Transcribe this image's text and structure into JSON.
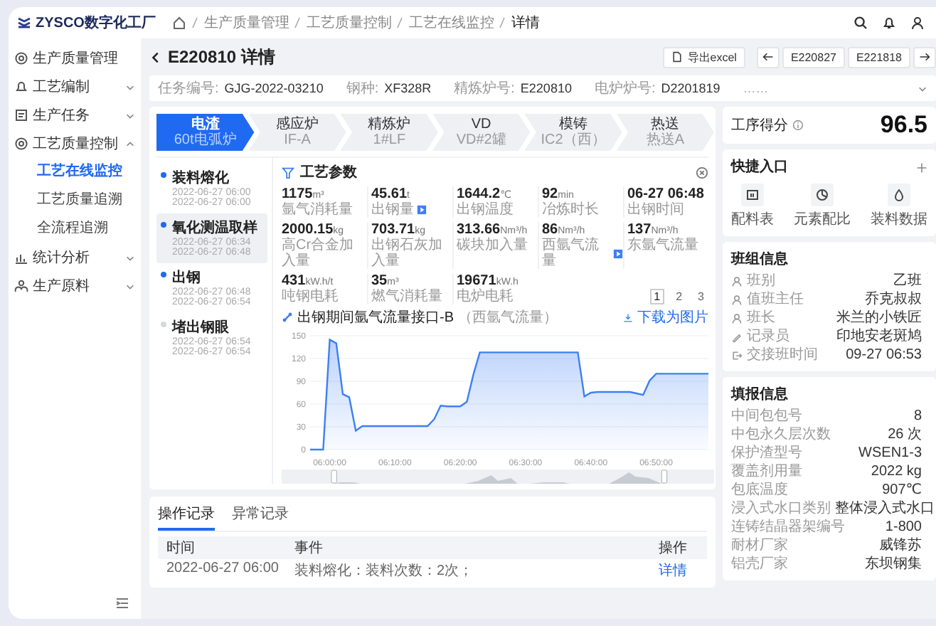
{
  "logo": "ZYSCO数字化工厂",
  "breadcrumb": [
    "生产质量管理",
    "工艺质量控制",
    "工艺在线监控",
    "详情"
  ],
  "sidebar": {
    "items": [
      {
        "label": "生产质量管理"
      },
      {
        "label": "工艺编制",
        "expanded": false
      },
      {
        "label": "生产任务",
        "expanded": false
      },
      {
        "label": "工艺质量控制",
        "expanded": true,
        "children": [
          {
            "label": "工艺在线监控",
            "selected": true
          },
          {
            "label": "工艺质量追溯",
            "selected": false
          },
          {
            "label": "全流程追溯",
            "selected": false
          }
        ]
      },
      {
        "label": "统计分析",
        "expanded": false
      },
      {
        "label": "生产原料",
        "expanded": false
      }
    ]
  },
  "page_title": "E220810 详情",
  "export_button": "导出excel",
  "nav": {
    "prev": "E220827",
    "next": "E221818"
  },
  "info_fields": [
    {
      "label": "任务编号:",
      "value": "GJG-2022-03210"
    },
    {
      "label": "钢种:",
      "value": "XF328R"
    },
    {
      "label": "精炼炉号:",
      "value": "E220810"
    },
    {
      "label": "电炉炉号:",
      "value": "D2201819"
    }
  ],
  "info_more": "……",
  "steps": [
    {
      "name": "电渣",
      "detail": "60t电弧炉",
      "selected": true
    },
    {
      "name": "感应炉",
      "detail": "IF-A",
      "selected": false
    },
    {
      "name": "精炼炉",
      "detail": "1#LF",
      "selected": false
    },
    {
      "name": "VD",
      "detail": "VD#2罐",
      "selected": false
    },
    {
      "name": "模铸",
      "detail": "IC2（西）",
      "selected": false
    },
    {
      "name": "热送",
      "detail": "热送A",
      "selected": false
    }
  ],
  "timeline": [
    {
      "name": "装料熔化",
      "start": "2022-06-27 06:00",
      "end": "2022-06-27 06:00",
      "done": true,
      "selected": false
    },
    {
      "name": "氧化测温取样",
      "start": "2022-06-27 06:34",
      "end": "2022-06-27 06:48",
      "done": true,
      "selected": true
    },
    {
      "name": "出钢",
      "start": "2022-06-27 06:48",
      "end": "2022-06-27 06:54",
      "done": true,
      "selected": false
    },
    {
      "name": "堵出钢眼",
      "start": "2022-06-27 06:54",
      "end": "2022-06-27 06:54",
      "done": false,
      "selected": false
    }
  ],
  "params": {
    "title": "工艺参数",
    "items": [
      {
        "value": "1175",
        "unit": "m³",
        "label": "氩气消耗量"
      },
      {
        "value": "45.61",
        "unit": "t",
        "label": "出钢量",
        "flag": true
      },
      {
        "value": "1644.2",
        "unit": "℃",
        "label": "出钢温度"
      },
      {
        "value": "92",
        "unit": "min",
        "label": "冶炼时长"
      },
      {
        "value": "06-27 06:48",
        "label": "出钢时间"
      },
      {
        "value": "2000.15",
        "unit": "kg",
        "label": "高Cr合金加入量"
      },
      {
        "value": "703.71",
        "unit": "kg",
        "label": "出钢石灰加入量"
      },
      {
        "value": "313.66",
        "unit": "Nm³/h",
        "label": "碳块加入量"
      },
      {
        "value": "86",
        "unit": "Nm³/h",
        "label": "西氩气流量",
        "flag": true
      },
      {
        "value": "137",
        "unit": "Nm³/h",
        "label": "东氩气流量"
      },
      {
        "value": "431",
        "unit": "kW.h/t",
        "label": "吨钢电耗"
      },
      {
        "value": "35",
        "unit": "m³",
        "label": "燃气消耗量"
      },
      {
        "value": "19671",
        "unit": "kW.h",
        "label": "电炉电耗"
      }
    ],
    "pages": [
      {
        "label": "1",
        "selected": true
      },
      {
        "label": "2",
        "selected": false
      },
      {
        "label": "3",
        "selected": false
      }
    ]
  },
  "chart": {
    "title": "出钢期间氩气流量接口-B",
    "subtitle": "（西氩气流量）",
    "download": "下载为图片",
    "chart_data": {
      "type": "area",
      "categories": [
        null,
        null,
        null,
        "06:00:00",
        null,
        null,
        null,
        null,
        null,
        null,
        null,
        null,
        null,
        "06:10:00",
        null,
        null,
        null,
        null,
        null,
        null,
        null,
        null,
        null,
        "06:20:00",
        null,
        null,
        null,
        null,
        null,
        null,
        null,
        null,
        null,
        "06:30:00",
        null,
        null,
        null,
        null,
        null,
        null,
        null,
        null,
        null,
        "06:40:00",
        null,
        null,
        null,
        null,
        null,
        null,
        null,
        null,
        null,
        "06:50:00",
        null,
        null,
        null,
        null,
        null,
        null,
        null,
        null
      ],
      "series": [
        {
          "color": "#3d7ff5",
          "values": [
            0,
            0,
            0,
            145,
            140,
            73,
            69,
            25,
            31,
            31,
            31,
            31,
            31,
            31,
            31,
            31,
            31,
            31,
            31,
            40,
            58,
            57,
            57,
            57,
            63,
            99,
            128,
            128,
            128,
            128,
            128,
            128,
            128,
            128,
            128,
            128,
            128,
            128,
            128,
            128,
            128,
            128,
            70,
            75,
            76,
            76,
            76,
            76,
            76,
            76,
            74,
            72,
            91,
            100,
            100,
            100,
            100,
            100,
            100,
            100,
            100,
            100
          ]
        }
      ],
      "ylim": [
        0,
        150
      ],
      "yticks": [
        0,
        30,
        60,
        90,
        120,
        150
      ],
      "grid": true
    }
  },
  "records": {
    "tabs": [
      {
        "label": "操作记录",
        "selected": true
      },
      {
        "label": "异常记录",
        "selected": false
      }
    ],
    "columns": [
      "时间",
      "事件",
      "操作"
    ],
    "rows": [
      [
        "2022-06-27 06:00",
        "装料熔化：装料次数：2次；",
        "详情"
      ]
    ]
  },
  "score": {
    "label": "工序得分",
    "value": "96.5"
  },
  "shortcuts": {
    "title": "快捷入口",
    "items": [
      "配料表",
      "元素配比",
      "装料数据"
    ]
  },
  "team": {
    "title": "班组信息",
    "rows": [
      {
        "label": "班别",
        "value": "乙班"
      },
      {
        "label": "值班主任",
        "value": "乔克叔叔"
      },
      {
        "label": "班长",
        "value": "米兰的小铁匠"
      },
      {
        "label": "记录员",
        "value": "印地安老斑鸠"
      },
      {
        "label": "交接班时间",
        "value": "09-27 06:53"
      }
    ]
  },
  "report": {
    "title": "填报信息",
    "rows": [
      {
        "label": "中间包包号",
        "value": "8"
      },
      {
        "label": "中包永久层次数",
        "value": "26 次"
      },
      {
        "label": "保护渣型号",
        "value": "WSEN1-3"
      },
      {
        "label": "覆盖剂用量",
        "value": "2022 kg"
      },
      {
        "label": "包底温度",
        "value": "907℃"
      },
      {
        "label": "浸入式水口类别",
        "value": "整体浸入式水口"
      },
      {
        "label": "连铸结晶器架编号",
        "value": "1-800"
      },
      {
        "label": "耐材厂家",
        "value": "威锋苏"
      },
      {
        "label": "铝壳厂家",
        "value": "东坝钢集"
      }
    ]
  }
}
